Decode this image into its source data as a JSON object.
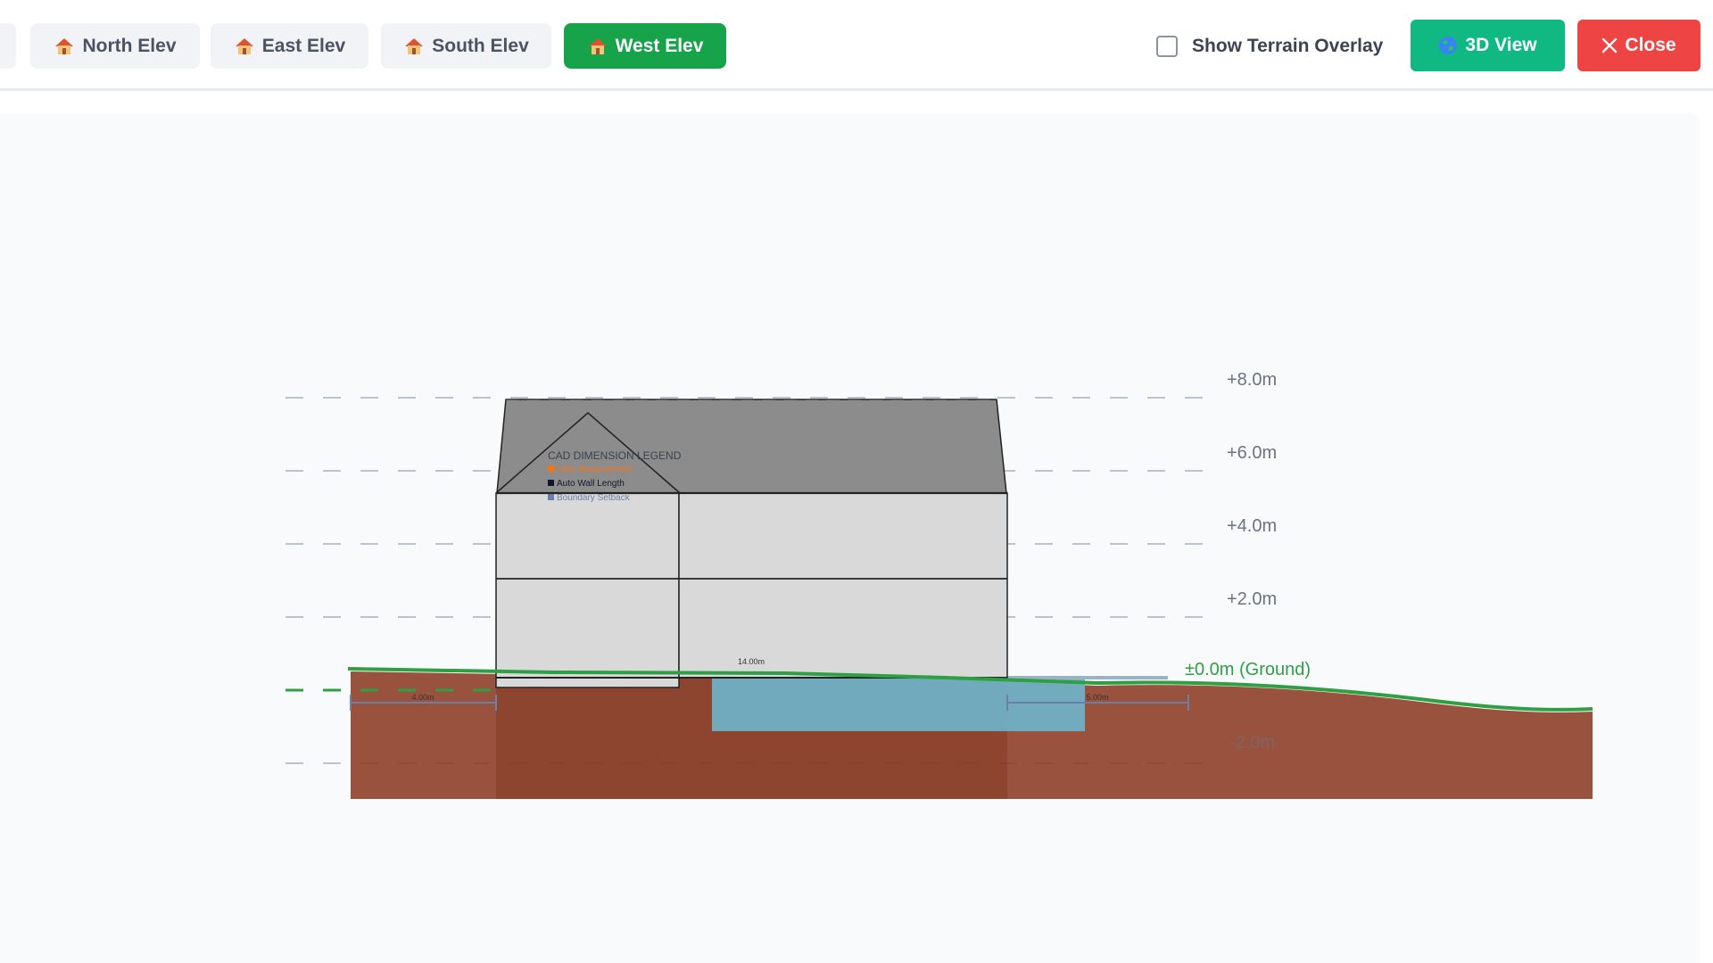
{
  "toolbar": {
    "tabs": [
      {
        "label": "North Elev",
        "active": false,
        "icon": "house-icon"
      },
      {
        "label": "East Elev",
        "active": false,
        "icon": "house-icon"
      },
      {
        "label": "South Elev",
        "active": false,
        "icon": "house-icon"
      },
      {
        "label": "West Elev",
        "active": true,
        "icon": "house-icon"
      }
    ],
    "terrain_overlay_label": "Show Terrain Overlay",
    "terrain_overlay_checked": false,
    "view3d_label": "3D View",
    "view3d_icon": "globe-icon",
    "close_label": "Close",
    "close_icon": "x-icon"
  },
  "drawing": {
    "level_labels": {
      "p8": "+8.0m",
      "p6": "+6.0m",
      "p4": "+4.0m",
      "p2": "+2.0m",
      "ground": "±0.0m (Ground)",
      "m2": "-2.0m"
    },
    "dimension_labels": {
      "left_setback": "4.00m",
      "building_width": "14.00m",
      "right_setback": "5.00m"
    },
    "legend": {
      "title": "CAD DIMENSION LEGEND",
      "items": [
        {
          "label": "User Measurement",
          "color": "#f97316"
        },
        {
          "label": "Auto Wall Length",
          "color": "#111827"
        },
        {
          "label": "Boundary Setback",
          "color": "#6b7fa8"
        }
      ]
    },
    "colors": {
      "ground_line": "#2ea043",
      "soil": "#8b3a22",
      "water": "#6fb0c4",
      "roof": "#8c8c8c",
      "wall": "#d9d9d9"
    }
  }
}
